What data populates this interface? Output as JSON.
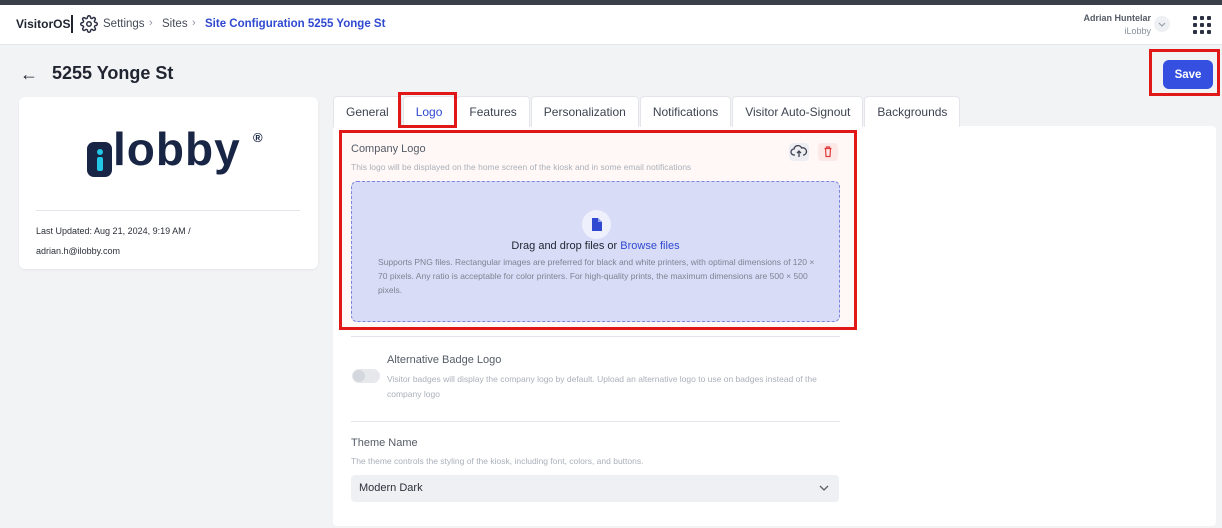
{
  "header": {
    "brand": "VisitorOS",
    "breadcrumb": {
      "settings": "Settings",
      "sites": "Sites",
      "current": "Site Configuration 5255 Yonge St"
    },
    "user": {
      "name": "Adrian Huntelar",
      "org": "iLobby"
    }
  },
  "page": {
    "title": "5255 Yonge St",
    "save_label": "Save"
  },
  "site_card": {
    "logo_text": "lobby",
    "logo_mark": "®",
    "last_updated": "Last Updated:  Aug 21, 2024, 9:19 AM  /",
    "updated_by": "adrian.h@ilobby.com"
  },
  "tabs": [
    "General",
    "Logo",
    "Features",
    "Personalization",
    "Notifications",
    "Visitor Auto-Signout",
    "Backgrounds"
  ],
  "company_logo": {
    "title": "Company Logo",
    "description": "This logo will be displayed on the home screen of the kiosk and in some email notifications",
    "drag_text": "Drag and drop files or ",
    "browse_link": "Browse files",
    "supports": "Supports PNG files. Rectangular images are preferred for black and white printers, with optimal dimensions of 120 × 70 pixels. Any ratio is acceptable for color printers. For high-quality prints, the maximum dimensions are 500 × 500 pixels."
  },
  "badge_logo": {
    "title": "Alternative Badge Logo",
    "description": "Visitor badges will display the company logo by default. Upload an alternative logo to use on badges instead of the company logo",
    "enabled": false
  },
  "theme": {
    "title": "Theme Name",
    "description": "The theme controls the styling of the kiosk, including font, colors, and buttons.",
    "selected": "Modern Dark"
  },
  "colors": {
    "accent": "#3550e0",
    "highlight": "#e01818",
    "dropzone": "#d9dcf7"
  }
}
